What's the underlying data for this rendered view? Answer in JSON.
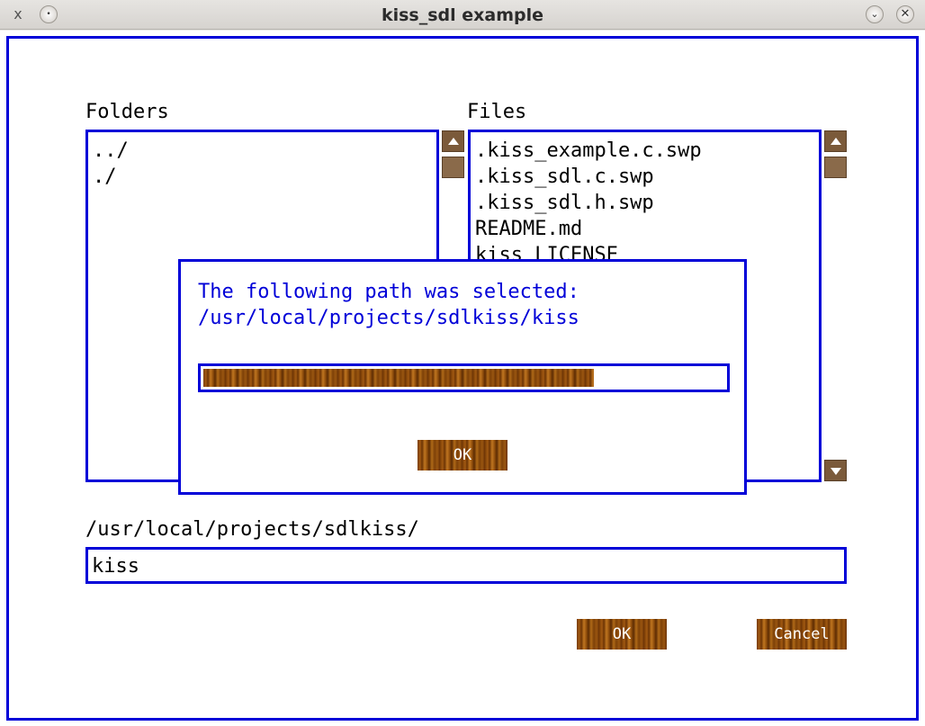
{
  "window": {
    "title": "kiss_sdl example",
    "app_icon": "x",
    "sticky_icon": "•",
    "minimize_icon": "⌄",
    "close_icon": "✕"
  },
  "folders": {
    "label": "Folders",
    "items": [
      "../",
      "./"
    ]
  },
  "files": {
    "label": "Files",
    "items": [
      ".kiss_example.c.swp",
      ".kiss_sdl.c.swp",
      ".kiss_sdl.h.swp",
      "README.md",
      "kiss_LICENSE"
    ]
  },
  "path": {
    "label": "/usr/local/projects/sdlkiss/",
    "entry_value": "kiss"
  },
  "buttons": {
    "ok": "OK",
    "cancel": "Cancel"
  },
  "dialog": {
    "line1": "The following path was selected:",
    "line2": "/usr/local/projects/sdlkiss/kiss",
    "progress": 0.75,
    "ok": "OK"
  },
  "colors": {
    "accent": "#0000d8",
    "wood": "#7a3d06"
  }
}
